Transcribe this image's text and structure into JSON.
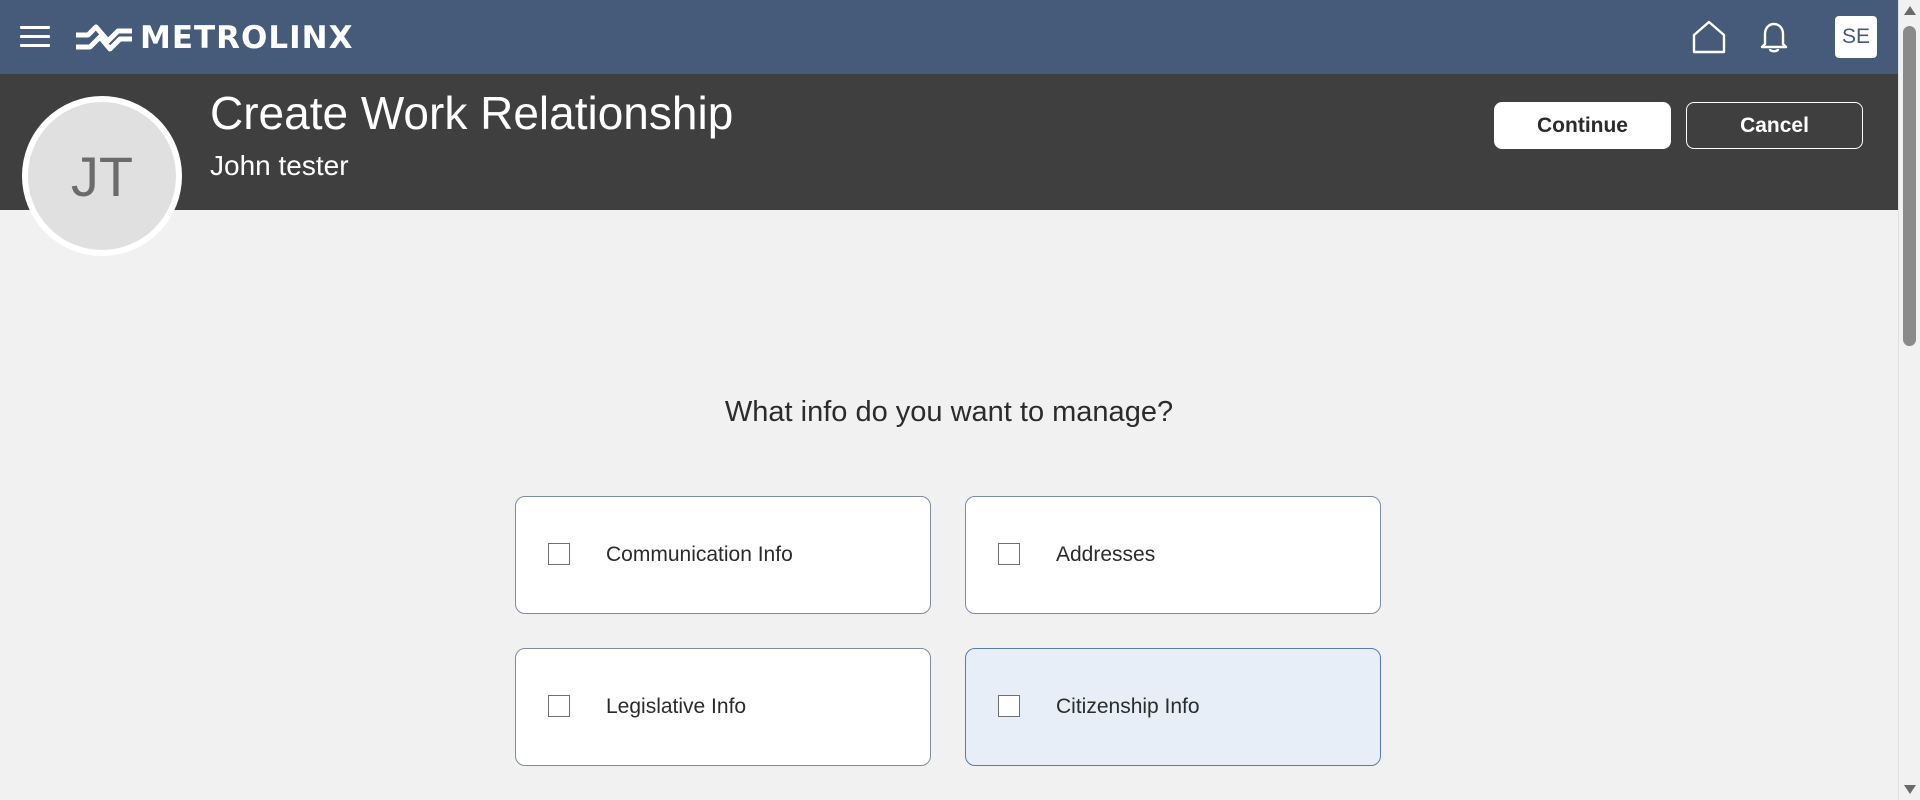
{
  "app": {
    "brand": "METROLINX",
    "user_initials": "SE"
  },
  "header": {
    "title": "Create Work Relationship",
    "subtitle": "John tester",
    "avatar_initials": "JT",
    "continue_label": "Continue",
    "cancel_label": "Cancel"
  },
  "main": {
    "question": "What info do you want to manage?",
    "options": [
      {
        "label": "Communication Info",
        "checked": false
      },
      {
        "label": "Addresses",
        "checked": false
      },
      {
        "label": "Legislative Info",
        "checked": false
      },
      {
        "label": "Citizenship Info",
        "checked": false,
        "highlighted": true
      }
    ]
  },
  "colors": {
    "topbar": "#465a7a",
    "header": "#3f3f3f",
    "background": "#f1f1f1",
    "card_border": "#7d8ba3",
    "card_highlight": "#e7eef8"
  },
  "icons": {
    "menu": "hamburger-menu-icon",
    "logo": "metrolinx-logo-icon",
    "home": "home-icon",
    "notifications": "bell-icon"
  }
}
